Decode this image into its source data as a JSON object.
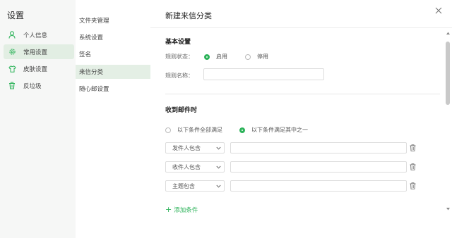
{
  "sidebar": {
    "title": "设置",
    "items": [
      {
        "label": "个人信息",
        "icon": "user-icon"
      },
      {
        "label": "常用设置",
        "icon": "gear-icon"
      },
      {
        "label": "皮肤设置",
        "icon": "shirt-icon"
      },
      {
        "label": "反垃圾",
        "icon": "trash-bin-icon"
      }
    ]
  },
  "submenu": {
    "items": [
      {
        "label": "文件夹管理"
      },
      {
        "label": "系统设置"
      },
      {
        "label": "签名"
      },
      {
        "label": "来信分类"
      },
      {
        "label": "随心邮设置"
      }
    ]
  },
  "dialog": {
    "title": "新建来信分类",
    "basic": {
      "heading": "基本设置",
      "status_label": "规则状态：",
      "status_on": "启用",
      "status_off": "停用",
      "name_label": "规则名称：",
      "name_value": ""
    },
    "receive": {
      "heading": "收到邮件时",
      "match_all": "以下条件全部满足",
      "match_any": "以下条件满足其中之一",
      "conditions": [
        {
          "field": "发件人包含",
          "value": ""
        },
        {
          "field": "收件人包含",
          "value": ""
        },
        {
          "field": "主题包含",
          "value": ""
        }
      ],
      "add_label": "添加条件"
    }
  },
  "colors": {
    "accent": "#2db35a",
    "active_bg": "#e2eee3"
  }
}
